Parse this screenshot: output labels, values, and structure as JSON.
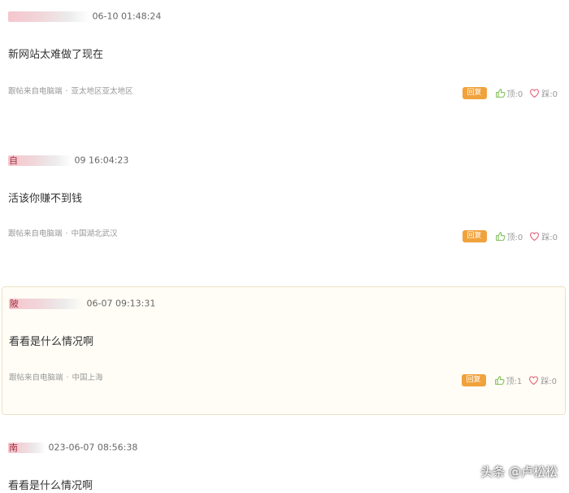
{
  "comments": [
    {
      "user_char": "",
      "time": "06-10 01:48:24",
      "content": "新网站太难做了现在",
      "source_device": "跟帖来自电脑端",
      "location": "亚太地区亚太地区",
      "reply_label": "回复",
      "up_label": "顶:0",
      "down_label": "踩:0"
    },
    {
      "user_char": "自",
      "time": "09 16:04:23",
      "content": "活该你赚不到钱",
      "source_device": "跟帖来自电脑端",
      "location": "中国湖北武汉",
      "reply_label": "回复",
      "up_label": "顶:0",
      "down_label": "踩:0"
    },
    {
      "user_char": "陂",
      "time": "06-07 09:13:31",
      "content": "看看是什么情况啊",
      "source_device": "跟帖来自电脑端",
      "location": "中国上海",
      "reply_label": "回复",
      "up_label": "顶:1",
      "down_label": "踩:0"
    },
    {
      "user_char": "南",
      "time": "023-06-07 08:56:38",
      "content": "看看是什么情况啊"
    }
  ],
  "watermark": "头条 @卢松松",
  "icons": {
    "up": "thumbs-up-icon",
    "down": "heart-icon"
  },
  "colors": {
    "reply_button": "#f0a23c",
    "icon_green": "#7fbf57",
    "icon_pink": "#e05d78",
    "highlight_bg": "#fffdf6"
  }
}
